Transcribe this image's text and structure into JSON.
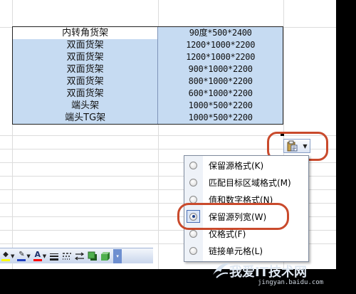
{
  "table": {
    "rows": [
      [
        "内转角货架",
        "90度*500*2400"
      ],
      [
        "双面货架",
        "1200*1000*2200"
      ],
      [
        "双面货架",
        "1200*1000*2200"
      ],
      [
        "双面货架",
        "900*1000*2200"
      ],
      [
        "双面货架",
        "800*1000*2200"
      ],
      [
        "双面货架",
        "600*1000*2200"
      ],
      [
        "端头架",
        "1000*500*2200"
      ],
      [
        "端头TG架",
        "1000*500*2200"
      ]
    ]
  },
  "paste_options": {
    "button_icon": "paste-options-icon",
    "items": [
      {
        "label": "保留源格式(K)",
        "selected": false
      },
      {
        "label": "匹配目标区域格式(M)",
        "selected": false
      },
      {
        "label": "值和数字格式(N)",
        "selected": false
      },
      {
        "label": "保留源列宽(W)",
        "selected": true
      },
      {
        "label": "仅格式(F)",
        "selected": false
      },
      {
        "label": "链接单元格(L)",
        "selected": false
      }
    ]
  },
  "toolbar": {
    "font_color_label": "A",
    "fill_color": "#ffff00",
    "font_color": "#ff0000",
    "line_color": "#1f3fbf"
  },
  "watermark": {
    "text": "我爱IT技术网",
    "url": "jingyan.baidu.com"
  },
  "colors": {
    "selection": "#c6dbf2",
    "highlight_ring": "#c94a2c"
  }
}
